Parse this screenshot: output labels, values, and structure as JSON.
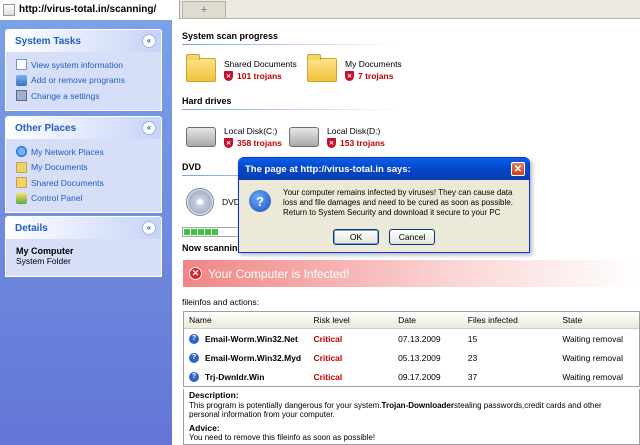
{
  "browser": {
    "tab_title": "http://virus-total.in/scanning/",
    "new_tab": "+"
  },
  "sidebar": {
    "system_tasks": {
      "title": "System Tasks",
      "items": [
        {
          "label": "View system information",
          "icon": "info-icon"
        },
        {
          "label": "Add or remove programs",
          "icon": "programs-icon"
        },
        {
          "label": "Change a settings",
          "icon": "settings-icon"
        }
      ]
    },
    "other_places": {
      "title": "Other Places",
      "items": [
        {
          "label": "My Network Places",
          "icon": "network-icon"
        },
        {
          "label": "My Documents",
          "icon": "folder-icon"
        },
        {
          "label": "Shared Documents",
          "icon": "folder-icon"
        },
        {
          "label": "Control Panel",
          "icon": "control-panel-icon"
        }
      ]
    },
    "details": {
      "title": "Details",
      "name": "My Computer",
      "type": "System Folder"
    },
    "chevron": "«"
  },
  "main": {
    "scan_progress_title": "System scan progress",
    "folders": [
      {
        "name": "Shared Documents",
        "trojans": "101 trojans"
      },
      {
        "name": "My Documents",
        "trojans": "7 trojans"
      }
    ],
    "hard_drives_title": "Hard drives",
    "drives": [
      {
        "name": "Local Disk(C:)",
        "trojans": "358 trojans"
      },
      {
        "name": "Local Disk(D:)",
        "trojans": "153 trojans"
      }
    ],
    "dvd_title": "DVD",
    "dvd_name": "DVD",
    "now_scanning": "Now scanning",
    "progress": 0.45,
    "infected_banner": "Your Computer is Infected!",
    "fileinfo_label": "fileinfos and actions:",
    "table": {
      "columns": [
        "Name",
        "Risk level",
        "Date",
        "Files infected",
        "State"
      ],
      "rows": [
        [
          "Email-Worm.Win32.Net",
          "Critical",
          "07.13.2009",
          "15",
          "Waiting removal"
        ],
        [
          "Email-Worm.Win32.Myd",
          "Critical",
          "05.13.2009",
          "23",
          "Waiting removal"
        ],
        [
          "Trj-Dwnldr.Win",
          "Critical",
          "09.17.2009",
          "37",
          "Waiting removal"
        ]
      ]
    },
    "description": {
      "heading": "Description:",
      "text_before": "This program is potentially dangerous for your system.",
      "text_bold": "Trojan-Downloader",
      "text_after": "stealing passwords,credit cards and other personal information from your computer.",
      "advice_heading": "Advice:",
      "advice_text": "You need to remove this fileinfo as soon as possible!"
    }
  },
  "dialog": {
    "title": "The page at http://virus-total.in says:",
    "message": "Your computer remains infected by viruses! They can cause data loss and file damages and need to be cured as soon as possible. Return to System Security and download it secure to your PC",
    "ok_label": "OK",
    "cancel_label": "Cancel"
  },
  "colors": {
    "danger": "#c00000",
    "xp_blue": "#215dc6",
    "progress_green": "#3ec440"
  }
}
